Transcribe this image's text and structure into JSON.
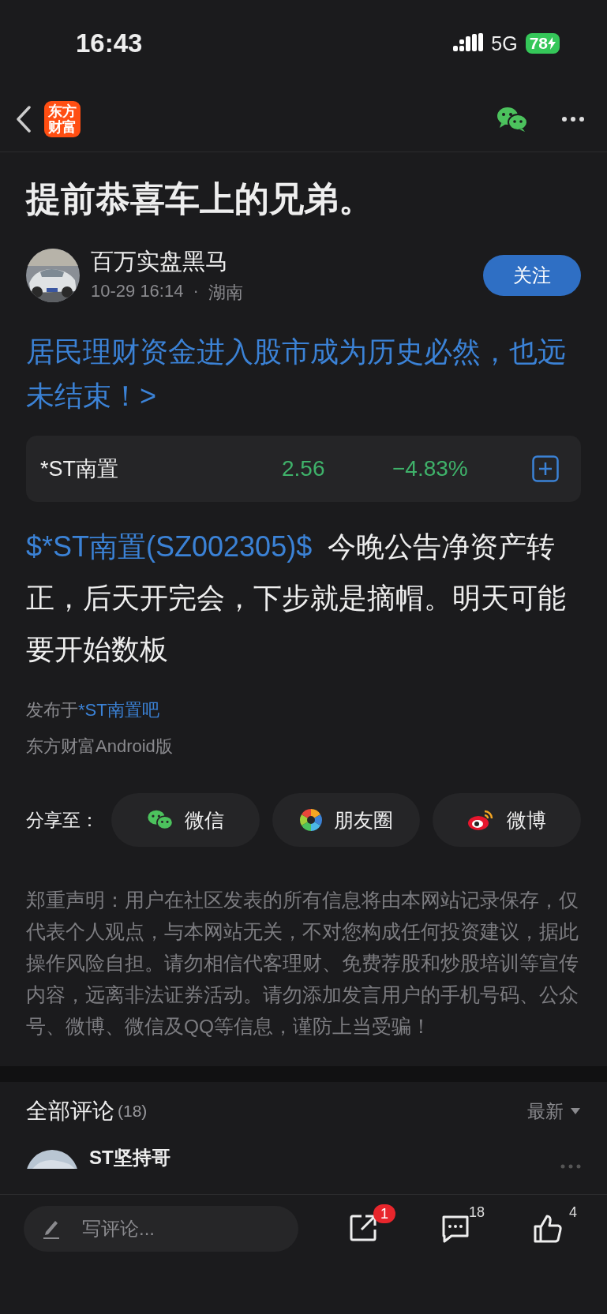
{
  "status_bar": {
    "time": "16:43",
    "network": "5G",
    "battery": "78"
  },
  "nav": {
    "logo": [
      "东方",
      "财富"
    ]
  },
  "post": {
    "title": "提前恭喜车上的兄弟。",
    "author": {
      "name": "百万实盘黑马",
      "time": "10-29 16:14",
      "separator": "·",
      "location": "湖南",
      "follow_label": "关注"
    },
    "headline_link": "居民理财资金进入股市成为历史必然，也远未结束！>",
    "stock": {
      "name": "*ST南置",
      "price": "2.56",
      "change": "−4.83%",
      "color": "#3fb26a"
    },
    "stock_tag": "$*ST南置(SZ002305)$",
    "body": "今晚公告净资产转正，后天开完会，下步就是摘帽。明天可能要开始数板",
    "published_prefix": "发布于",
    "forum": "*ST南置吧",
    "client": "东方财富Android版"
  },
  "share": {
    "label": "分享至：",
    "targets": [
      {
        "kind": "wechat",
        "label": "微信"
      },
      {
        "kind": "moments",
        "label": "朋友圈"
      },
      {
        "kind": "weibo",
        "label": "微博"
      }
    ]
  },
  "disclaimer": "郑重声明：用户在社区发表的所有信息将由本网站记录保存，仅代表个人观点，与本网站无关，不对您构成任何投资建议，据此操作风险自担。请勿相信代客理财、免费荐股和炒股培训等宣传内容，远离非法证券活动。请勿添加发言用户的手机号码、公众号、微博、微信及QQ等信息，谨防上当受骗！",
  "comments": {
    "title": "全部评论",
    "count": "(18)",
    "sort": "最新",
    "first_author": "ST坚持哥"
  },
  "bottom_bar": {
    "placeholder": "写评论...",
    "share_badge": "1",
    "comment_count": "18",
    "like_count": "4"
  }
}
